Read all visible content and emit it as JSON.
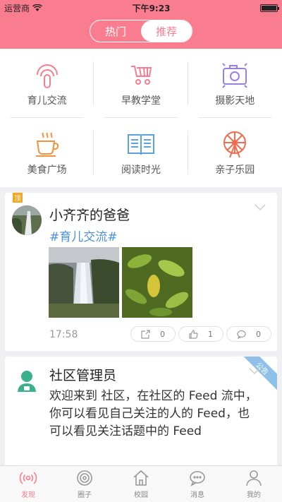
{
  "status": {
    "carrier": "运营商",
    "time": "下午9:23"
  },
  "segment": {
    "tabs": [
      "热门",
      "推荐"
    ],
    "selected": "推荐"
  },
  "categories": [
    {
      "label": "育儿交流",
      "icon": "parenting-icon",
      "color": "#f97d8f"
    },
    {
      "label": "早教学堂",
      "icon": "stroller-icon",
      "color": "#f97d8f"
    },
    {
      "label": "摄影天地",
      "icon": "camera-icon",
      "color": "#9b7fe0"
    },
    {
      "label": "美食广场",
      "icon": "coffee-cup-icon",
      "color": "#f5923e"
    },
    {
      "label": "阅读时光",
      "icon": "book-icon",
      "color": "#5aa2e0"
    },
    {
      "label": "亲子乐园",
      "icon": "ferris-wheel-icon",
      "color": "#f26c4f"
    }
  ],
  "posts": [
    {
      "badge": "顶",
      "author": "小齐齐的爸爸",
      "topic": "#育儿交流#",
      "time": "17:58",
      "actions": {
        "share": "0",
        "like": "1",
        "comment": "0"
      }
    },
    {
      "ribbon": "公告",
      "author": "社区管理员",
      "body": "欢迎来到 社区，在社区的 Feed 流中，你可以看见自己关注的人的 Feed，也可以看见关注话题中的 Feed"
    }
  ],
  "tabbar": [
    {
      "label": "发现",
      "icon": "broadcast-icon",
      "active": true
    },
    {
      "label": "圈子",
      "icon": "circle-icon",
      "active": false
    },
    {
      "label": "校园",
      "icon": "home-icon",
      "active": false
    },
    {
      "label": "消息",
      "icon": "chat-icon",
      "active": false
    },
    {
      "label": "我的",
      "icon": "person-icon",
      "active": false
    }
  ]
}
